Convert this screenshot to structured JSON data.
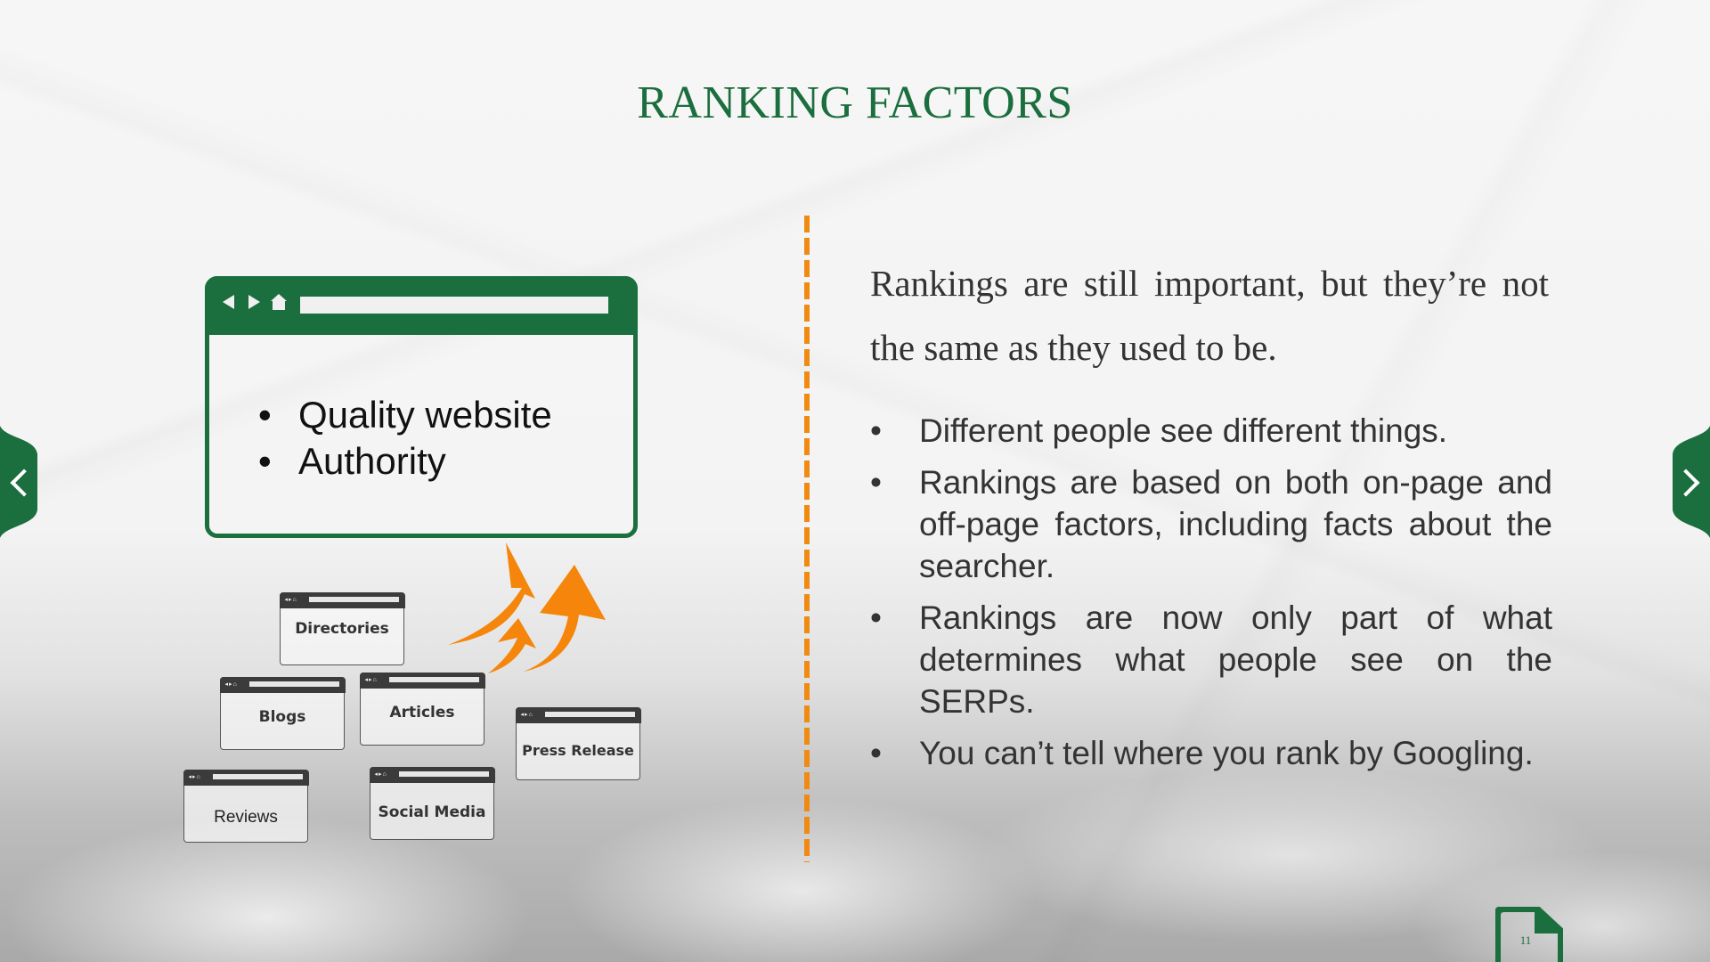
{
  "slide": {
    "title": "RANKING FACTORS",
    "page_number": "11",
    "colors": {
      "accent_green": "#1b6e3d",
      "accent_orange": "#f08a12",
      "body_text": "#333333"
    }
  },
  "left_panel": {
    "main_browser": {
      "icons": [
        "back-arrow-icon",
        "forward-arrow-icon",
        "home-icon"
      ],
      "bullets": [
        "Quality website",
        "Authority"
      ]
    },
    "source_browsers": [
      {
        "label": "Directories"
      },
      {
        "label": "Blogs"
      },
      {
        "label": "Articles"
      },
      {
        "label": "Press Release"
      },
      {
        "label": "Reviews"
      },
      {
        "label": "Social Media"
      }
    ],
    "arrows_icon": "rising-arrows-icon",
    "small_nav_glyph": "◂▸⌂"
  },
  "right_panel": {
    "intro": "Rankings are still important, but they’re not the same as they used to be.",
    "bullets": [
      "Different people see different things.",
      "Rankings are based on both on-page and off-page factors, including facts about the searcher.",
      "Rankings are now only part of what determines what people see on the SERPs.",
      "You can’t tell where you rank by Googling."
    ],
    "bullet_glyph": "•"
  },
  "navigation": {
    "prev_icon": "chevron-left-icon",
    "next_icon": "chevron-right-icon"
  }
}
